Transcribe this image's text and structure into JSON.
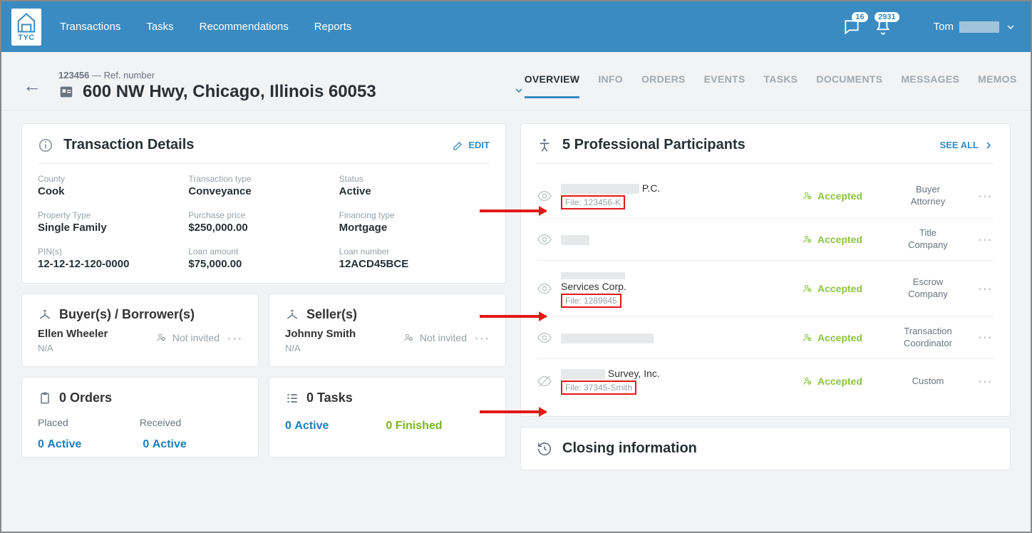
{
  "nav": {
    "transactions": "Transactions",
    "tasks": "Tasks",
    "recommendations": "Recommendations",
    "reports": "Reports"
  },
  "badges": {
    "chat": "16",
    "bell": "2931"
  },
  "user": {
    "name": "Tom"
  },
  "ref": {
    "number": "123456",
    "suffix": " — Ref. number"
  },
  "address": "600 NW Hwy, Chicago, Illinois 60053",
  "tabs": {
    "overview": "OVERVIEW",
    "info": "INFO",
    "orders": "ORDERS",
    "events": "EVENTS",
    "tasks": "TASKS",
    "documents": "DOCUMENTS",
    "messages": "MESSAGES",
    "memos": "MEMOS"
  },
  "details": {
    "title": "Transaction Details",
    "edit": "EDIT",
    "fields": {
      "county_l": "County",
      "county_v": "Cook",
      "ttype_l": "Transaction type",
      "ttype_v": "Conveyance",
      "status_l": "Status",
      "status_v": "Active",
      "ptype_l": "Property Type",
      "ptype_v": "Single Family",
      "pprice_l": "Purchase price",
      "pprice_v": "$250,000.00",
      "ftype_l": "Financing type",
      "ftype_v": "Mortgage",
      "pin_l": "PIN(s)",
      "pin_v": "12-12-12-120-0000",
      "loan_l": "Loan amount",
      "loan_v": "$75,000.00",
      "loann_l": "Loan number",
      "loann_v": "12ACD45BCE"
    }
  },
  "buyers": {
    "title": "Buyer(s) / Borrower(s)",
    "name": "Ellen Wheeler",
    "sub": "N/A",
    "status": "Not invited"
  },
  "sellers": {
    "title": "Seller(s)",
    "name": "Johnny Smith",
    "sub": "N/A",
    "status": "Not invited"
  },
  "orders": {
    "title": "0 Orders",
    "placed": "Placed",
    "received": "Received",
    "active": "Active",
    "n1": "0",
    "n2": "0"
  },
  "tasksCard": {
    "title": "0 Tasks",
    "active": "Active",
    "finished": "Finished",
    "n1": "0",
    "n2": "0"
  },
  "participants": {
    "title": "5 Professional Participants",
    "seeall": "SEE ALL",
    "accepted": "Accepted",
    "rows": {
      "r0": {
        "suffix": " P.C.",
        "file": "File: 123456-K",
        "role1": "Buyer",
        "role2": "Attorney"
      },
      "r1": {
        "role1": "Title",
        "role2": "Company"
      },
      "r2": {
        "line1": "Services Corp.",
        "file": "File: 1289645",
        "role1": "Escrow",
        "role2": "Company"
      },
      "r3": {
        "role1": "Transaction",
        "role2": "Coordinator"
      },
      "r4": {
        "suffix": " Survey, Inc.",
        "file": "File: 37345-Smith",
        "role1": "Custom"
      }
    }
  },
  "closing": {
    "title": "Closing information"
  }
}
